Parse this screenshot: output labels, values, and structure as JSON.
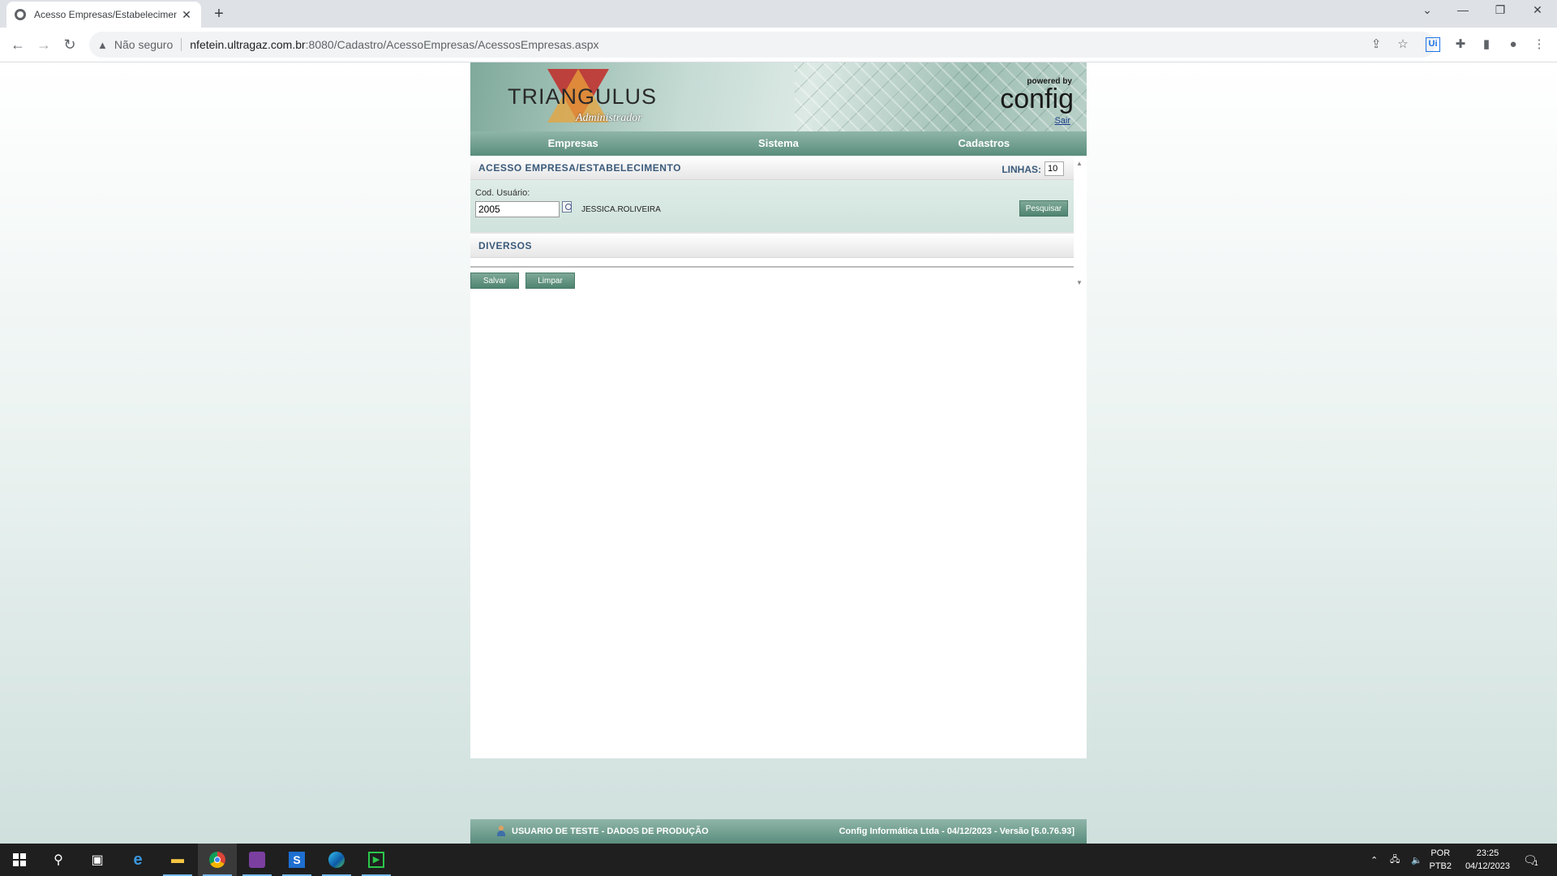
{
  "browser": {
    "tab_title": "Acesso Empresas/Estabelecimen",
    "new_tab": "+",
    "tab_close": "✕",
    "security": "Não seguro",
    "url_host": "nfetein.ultragaz.com.br",
    "url_path": ":8080/Cadastro/AcessoEmpresas/AcessosEmpresas.aspx"
  },
  "banner": {
    "logo": "TRIANGULUS",
    "logo_sub": "Administrador",
    "powered_by": "powered by",
    "brand": "config",
    "logout": "Sair"
  },
  "menu": {
    "items": [
      {
        "label": "Empresas"
      },
      {
        "label": "Sistema"
      },
      {
        "label": "Cadastros"
      }
    ]
  },
  "section_acesso": {
    "title": "ACESSO EMPRESA/ESTABELECIMENTO",
    "linhas_label": "LINHAS:",
    "linhas_value": "10"
  },
  "filter": {
    "user_code_label": "Cod. Usuário:",
    "user_code_value": "2005",
    "user_name": "JESSICA.ROLIVEIRA",
    "search_button": "Pesquisar"
  },
  "section_diversos": {
    "title": "DIVERSOS"
  },
  "actions": {
    "save": "Salvar",
    "clear": "Limpar"
  },
  "status": {
    "left": "USUARIO DE TESTE - DADOS DE PRODUÇÃO",
    "right": "Config Informática Ltda - 04/12/2023 - Versão [6.0.76.93]"
  },
  "taskbar": {
    "lang_top": "POR",
    "lang_bottom": "PTB2",
    "time": "23:25",
    "date": "04/12/2023",
    "notifications": "1"
  },
  "colors": {
    "menu_green": "#5a8d7d",
    "section_title_blue": "#3a5a7a",
    "taskbar": "#1f1f1f"
  }
}
